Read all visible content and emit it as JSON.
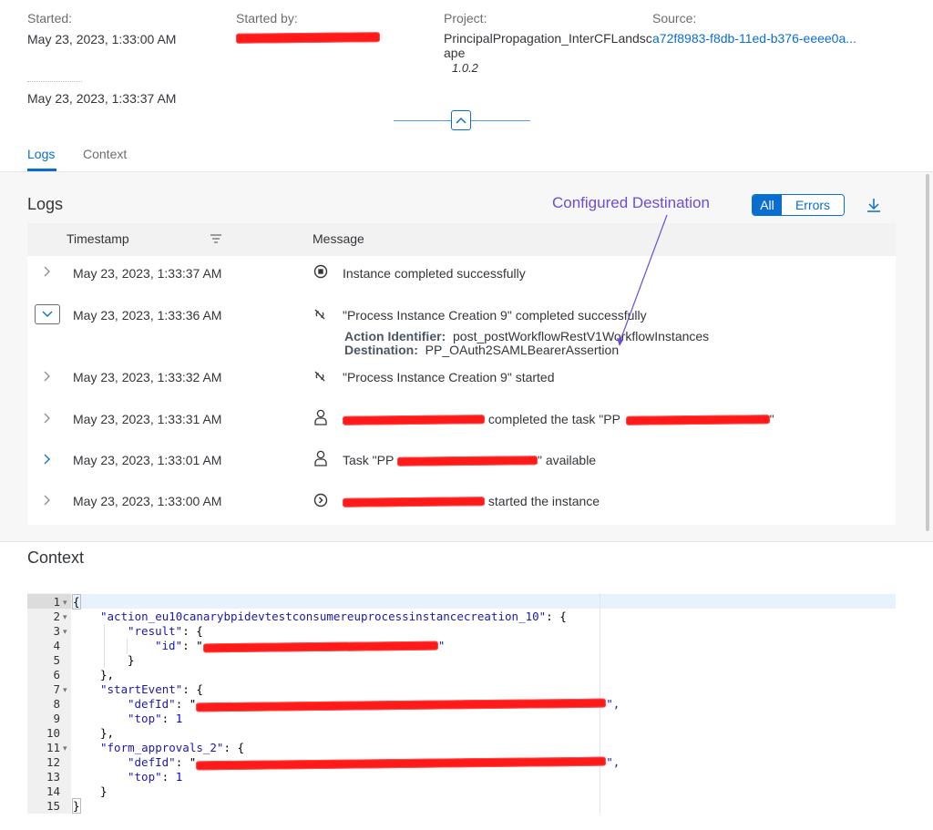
{
  "header": {
    "started_label": "Started:",
    "started_value": "May 23, 2023, 1:33:00 AM",
    "started_by_label": "Started by:",
    "project_label": "Project:",
    "project_value_line1": "PrincipalPropagation_InterCFLandsc",
    "project_value_line2": "ape",
    "project_version": "1.0.2",
    "source_label": "Source:",
    "source_value": "a72f8983-f8db-11ed-b376-eeee0a...",
    "ended_value": "May 23, 2023, 1:33:37 AM"
  },
  "tabs": [
    {
      "label": "Logs",
      "active": true
    },
    {
      "label": "Context",
      "active": false
    }
  ],
  "logs": {
    "title": "Logs",
    "annotation": "Configured Destination",
    "filter_all": "All",
    "filter_errors": "Errors",
    "columns": {
      "timestamp": "Timestamp",
      "message": "Message"
    },
    "rows": [
      {
        "timestamp": "May 23, 2023, 1:33:37 AM",
        "icon": "stop-circle-icon",
        "message": "Instance completed successfully"
      },
      {
        "timestamp": "May 23, 2023, 1:33:36 AM",
        "icon": "connector-icon",
        "message": "\"Process Instance Creation 9\" completed successfully",
        "detail_label_1": "Action Identifier:",
        "detail_value_1": "post_postWorkflowRestV1WorkflowInstances",
        "detail_label_2": "Destination:",
        "detail_value_2": "PP_OAuth2SAMLBearerAssertion"
      },
      {
        "timestamp": "May 23, 2023, 1:33:32 AM",
        "icon": "connector-icon",
        "message": "\"Process Instance Creation 9\" started"
      },
      {
        "timestamp": "May 23, 2023, 1:33:31 AM",
        "icon": "person-icon",
        "message_mid": "completed the task \"PP",
        "message_end": "\""
      },
      {
        "timestamp": "May 23, 2023, 1:33:01 AM",
        "icon": "person-icon",
        "message_start": "Task \"PP",
        "message_end": "\" available"
      },
      {
        "timestamp": "May 23, 2023, 1:33:00 AM",
        "icon": "play-circle-icon",
        "message_mid": "started the instance"
      }
    ]
  },
  "context": {
    "title": "Context",
    "code": {
      "l1": "{",
      "l2_key": "\"action_eu10canarybpidevtestconsumereuprocessinstancecreation_10\"",
      "l2_tail": ": {",
      "l3_key": "\"result\"",
      "l3_tail": ": {",
      "l4_key": "\"id\"",
      "l4_tail": ": \"",
      "l4_end": "\"",
      "l5": "}",
      "l6": "},",
      "l7_key": "\"startEvent\"",
      "l7_tail": ": {",
      "l8_key": "\"defId\"",
      "l8_tail": ": \"",
      "l8_end": "\",",
      "l9_key": "\"top\"",
      "l9_sep": ": ",
      "l9_val": "1",
      "l10": "},",
      "l11_key": "\"form_approvals_2\"",
      "l11_tail": ": {",
      "l12_key": "\"defId\"",
      "l12_tail": ": \"",
      "l12_end": "\",",
      "l13_key": "\"top\"",
      "l13_sep": ": ",
      "l13_val": "1",
      "l14": "}",
      "l15": "}"
    },
    "line_numbers": [
      "1",
      "2",
      "3",
      "4",
      "5",
      "6",
      "7",
      "8",
      "9",
      "10",
      "11",
      "12",
      "13",
      "14",
      "15"
    ]
  }
}
